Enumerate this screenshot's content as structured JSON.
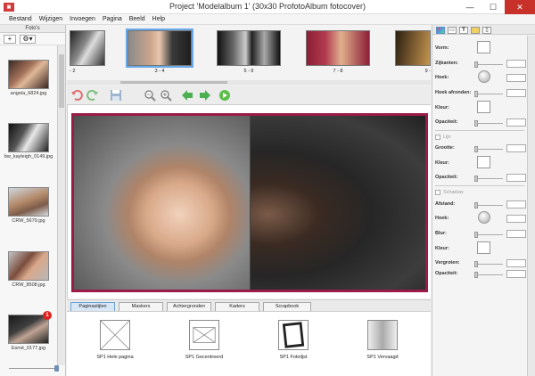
{
  "window": {
    "app_icon": "photo-album-app-icon",
    "title": "Project 'Modelalbum 1' (30x30 ProfotoAlbum fotocover)",
    "minimize": "—",
    "maximize": "☐",
    "close": "✕"
  },
  "menu": [
    "Bestand",
    "Wijzigen",
    "Invoegen",
    "Pagina",
    "Beeld",
    "Help"
  ],
  "left_panel": {
    "header": "Foto's",
    "add_label": "+",
    "settings_label": "⚙▾",
    "photos": [
      {
        "filename": "angela_6824.jpg"
      },
      {
        "filename": "bw_kayleigh_0149.jpg"
      },
      {
        "filename": "CRW_5679.jpg"
      },
      {
        "filename": "CRW_8508.jpg"
      },
      {
        "filename": "Esmé_0177.jpg",
        "badge": "1"
      }
    ]
  },
  "spreads": [
    {
      "label": "- 2"
    },
    {
      "label": "3 - 4",
      "selected": true
    },
    {
      "label": "5 - 6"
    },
    {
      "label": "7 - 8"
    },
    {
      "label": "9 -"
    }
  ],
  "toolbar": {
    "tools": [
      "undo-icon",
      "redo-icon",
      "save-icon",
      "zoom-out-icon",
      "zoom-in-icon",
      "arrow-left-icon",
      "arrow-right-icon",
      "play-icon"
    ]
  },
  "tabs": [
    "Paginastijlen",
    "Maskers",
    "Achtergronden",
    "Kaders",
    "Scrapbook"
  ],
  "active_tab": "Paginastijlen",
  "page_styles": [
    {
      "label": "SP1 Hele pagina"
    },
    {
      "label": "SP1 Gecentreerd"
    },
    {
      "label": "SP1 Fotolijst"
    },
    {
      "label": "SP1 Vervaagd"
    }
  ],
  "properties": {
    "tabs": [
      "colors-icon",
      "frame-icon",
      "text-icon",
      "ruler-icon",
      "page-icon"
    ],
    "shape_label": "Vorm:",
    "sides_label": "Zijkanten:",
    "angle_label": "Hoek:",
    "round_corners_label": "Hoek afronden:",
    "color_label": "Kleur:",
    "opacity_label": "Opaciteit:",
    "line_section": "Lijn",
    "line_size_label": "Grootte:",
    "line_color_label": "Kleur:",
    "line_opacity_label": "Opaciteit:",
    "shadow_section": "Schaduw",
    "distance_label": "Afstand:",
    "shadow_angle_label": "Hoek:",
    "blur_label": "Blur:",
    "shadow_color_label": "Kleur:",
    "enlarge_label": "Vergroten:",
    "shadow_opacity_label": "Opaciteit:"
  },
  "colors": {
    "selection": "#6aa9e8",
    "spread_border": "#9a1b47",
    "close": "#c7312a",
    "badge": "#e02020"
  }
}
